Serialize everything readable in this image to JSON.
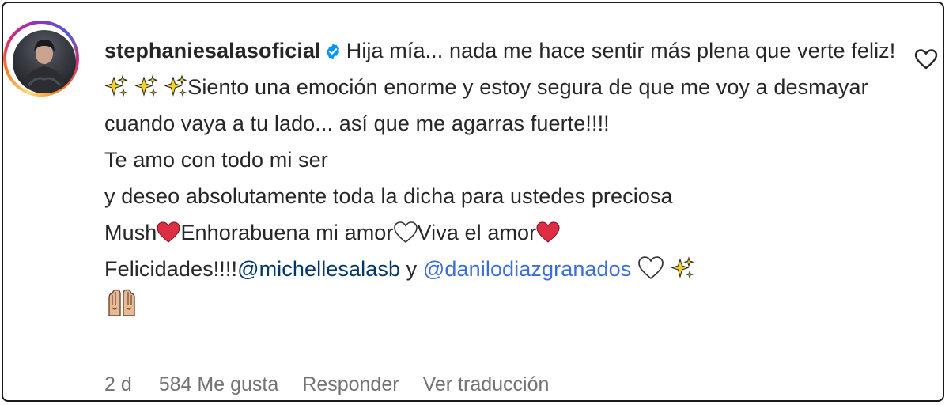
{
  "comment": {
    "username": "stephaniesalasoficial",
    "verified": true,
    "text_1": "Hija mía... nada me hace sentir más plena que verte feliz!",
    "text_2": "Siento una emoción enorme y estoy segura de que me voy a desmayar cuando vaya a tu lado... así que me agarras fuerte!!!!",
    "line_te_amo": "Te amo con todo mi ser",
    "line_deseo": "y deseo absolutamente toda la dicha para ustedes preciosa",
    "mush": "Mush",
    "enhorabuena": "Enhorabuena mi amor",
    "viva": "Viva el amor",
    "felicidades": "Felicidades!!!!",
    "mention_1": "@michellesalasb",
    "conj": " y ",
    "mention_2": "@danilodiazgranados",
    "emojis": [
      "sparkles-icon",
      "red-heart-icon",
      "white-heart-icon",
      "raised-hands-icon"
    ]
  },
  "footer": {
    "time": "2 d",
    "likes": "584 Me gusta",
    "reply": "Responder",
    "translate": "Ver traducción"
  },
  "colors": {
    "mention_link": "#00376b",
    "mention_link_2": "#3b6fd6",
    "verified_badge": "#0095f6",
    "secondary_text": "#737373"
  }
}
